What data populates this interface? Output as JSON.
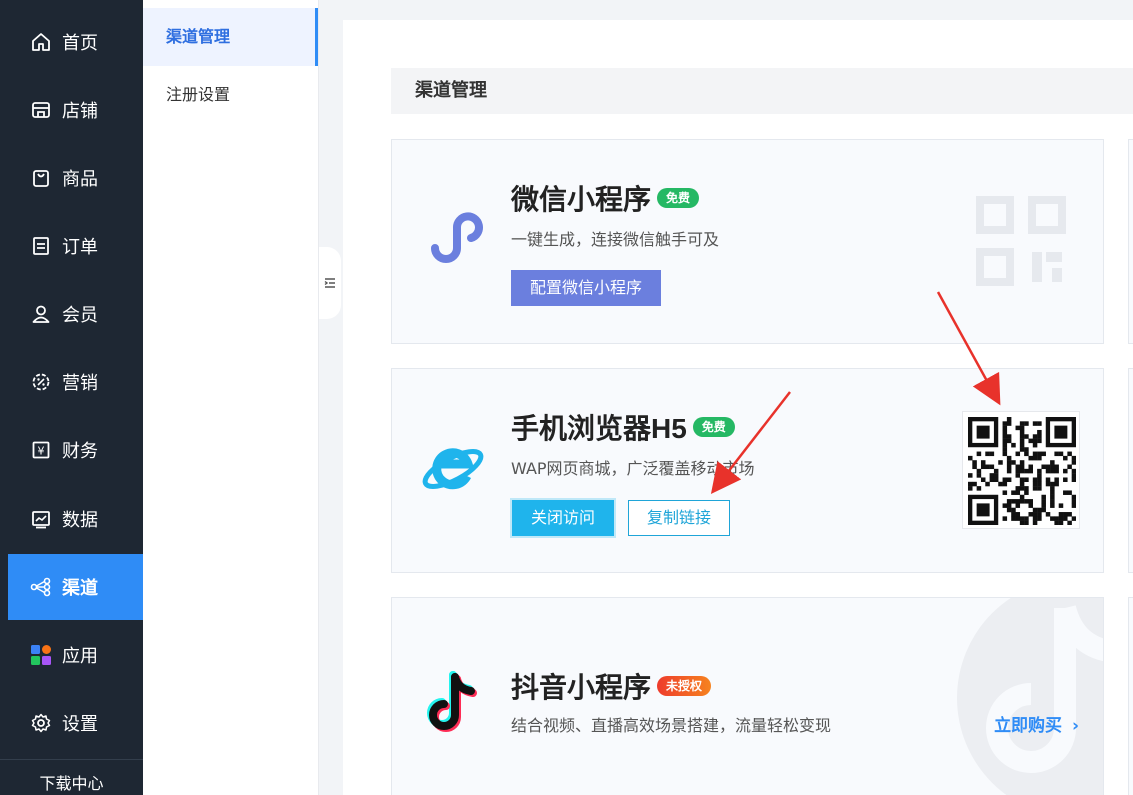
{
  "nav": {
    "items": [
      {
        "label": "首页",
        "icon": "home-icon"
      },
      {
        "label": "店铺",
        "icon": "store-icon"
      },
      {
        "label": "商品",
        "icon": "bag-icon"
      },
      {
        "label": "订单",
        "icon": "order-icon"
      },
      {
        "label": "会员",
        "icon": "user-icon"
      },
      {
        "label": "营销",
        "icon": "marketing-icon"
      },
      {
        "label": "财务",
        "icon": "finance-icon"
      },
      {
        "label": "数据",
        "icon": "chart-icon"
      },
      {
        "label": "渠道",
        "icon": "channel-icon",
        "active": true
      },
      {
        "label": "应用",
        "icon": "apps-icon"
      },
      {
        "label": "设置",
        "icon": "gear-icon"
      }
    ],
    "footer": "下载中心"
  },
  "subnav": {
    "items": [
      {
        "label": "渠道管理",
        "active": true
      },
      {
        "label": "注册设置"
      }
    ]
  },
  "section": {
    "title": "渠道管理"
  },
  "cards": {
    "wechat": {
      "title": "微信小程序",
      "badge": "免费",
      "desc": "一键生成，连接微信触手可及",
      "button": "配置微信小程序"
    },
    "h5": {
      "title": "手机浏览器H5",
      "badge": "免费",
      "desc": "WAP网页商城，广泛覆盖移动市场",
      "button_close": "关闭访问",
      "button_copy": "复制链接"
    },
    "douyin": {
      "title": "抖音小程序",
      "badge": "未授权",
      "desc": "结合视频、直播高效场景搭建，流量轻松变现",
      "buy": "立即购买"
    }
  },
  "colors": {
    "sidebar_bg": "#1e2733",
    "active_nav": "#2f8cf6",
    "wechat_purple": "#6b7fde",
    "h5_cyan": "#1fb4ec",
    "badge_green": "#25b864",
    "badge_red": "#ee3b2c",
    "annotation_red": "#e8322b"
  }
}
